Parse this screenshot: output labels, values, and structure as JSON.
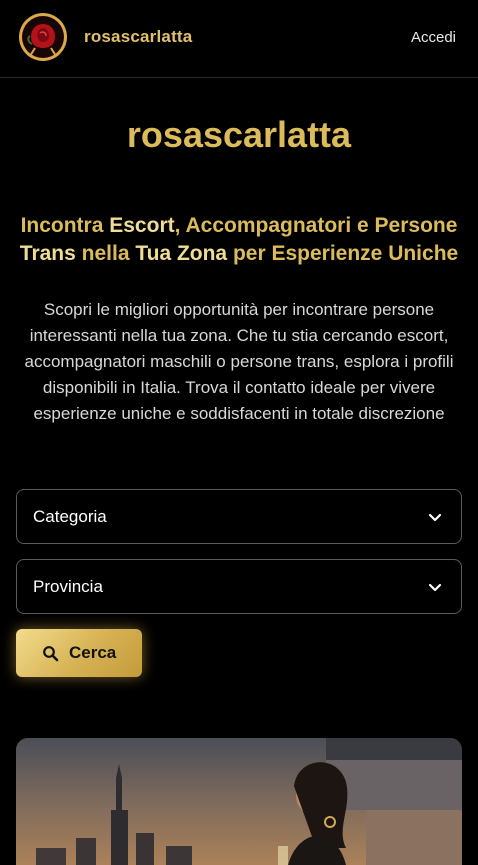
{
  "header": {
    "brand": "rosascarlatta",
    "login_label": "Accedi",
    "logo_icon": "rose-icon"
  },
  "hero": {
    "title": "rosascarlatta",
    "subtitle": {
      "part1": "Incontra ",
      "hl1": "Escort",
      "part2": ", Accompagnatori e Persone ",
      "hl2": "Trans",
      "part3": " nella ",
      "hl3": "Tua Zona",
      "part4": " per Esperienze Uniche"
    },
    "description": "Scopri le migliori opportunità per incontrare persone interessanti nella tua zona. Che tu stia cercando escort, accompagnatori maschili o persone trans, esplora i profili disponibili in Italia. Trova il contatto ideale per vivere esperienze uniche e soddisfacenti in totale discrezione"
  },
  "filters": {
    "category_label": "Categoria",
    "province_label": "Provincia",
    "search_label": "Cerca"
  },
  "colors": {
    "gold": "#dcbc5a",
    "gold_light": "#f0dd95",
    "background": "#000000"
  }
}
